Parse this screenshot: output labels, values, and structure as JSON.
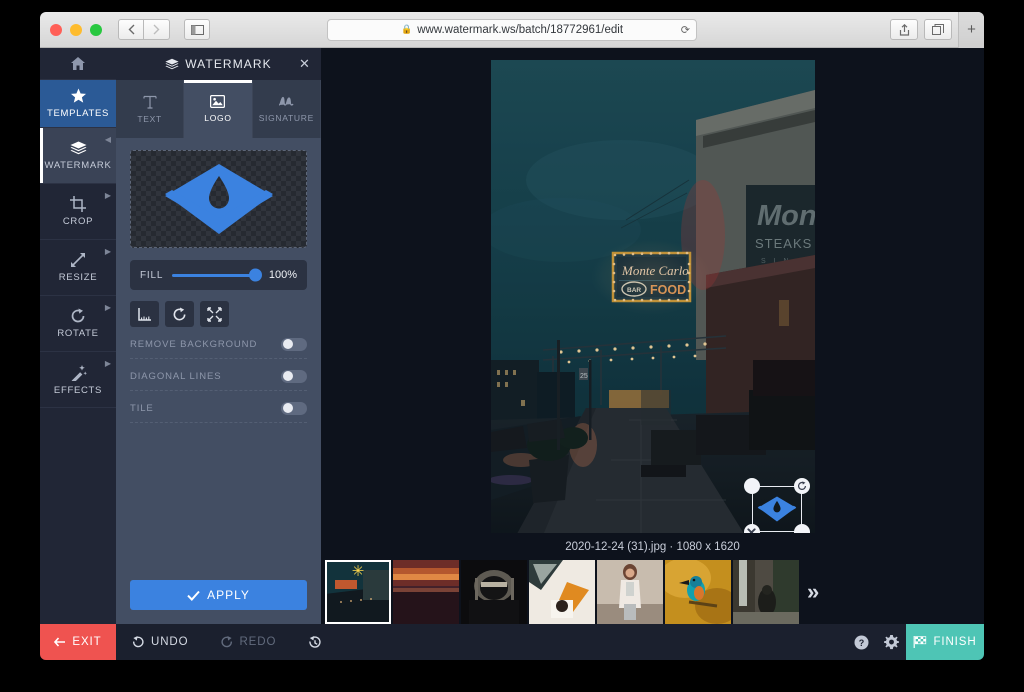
{
  "browser": {
    "url": "www.watermark.ws/batch/18772961/edit",
    "lock_icon": "lock-icon",
    "reload_icon": "reload-icon",
    "back_icon": "chevron-left-icon",
    "forward_icon": "chevron-right-icon",
    "sidebar_icon": "sidebar-toggle-icon",
    "share_icon": "share-icon",
    "tabs_icon": "show-tabs-icon",
    "new_tab_icon": "plus-icon"
  },
  "rail": {
    "home_icon": "home-icon",
    "items": [
      {
        "label": "TEMPLATES",
        "icon": "star-icon",
        "state": "accent"
      },
      {
        "label": "WATERMARK",
        "icon": "layers-icon",
        "state": "active"
      },
      {
        "label": "CROP",
        "icon": "crop-icon",
        "state": "normal"
      },
      {
        "label": "RESIZE",
        "icon": "resize-icon",
        "state": "normal"
      },
      {
        "label": "ROTATE",
        "icon": "rotate-icon",
        "state": "normal"
      },
      {
        "label": "EFFECTS",
        "icon": "magic-wand-icon",
        "state": "normal"
      }
    ]
  },
  "panel": {
    "title": "WATERMARK",
    "title_icon": "layers-icon",
    "close_icon": "close-icon",
    "tabs": [
      {
        "label": "TEXT",
        "icon": "text-icon"
      },
      {
        "label": "LOGO",
        "icon": "image-icon"
      },
      {
        "label": "SIGNATURE",
        "icon": "signature-icon"
      }
    ],
    "selected_tab": "LOGO",
    "logo_preview_name": "watermark-logo-droplet",
    "fill": {
      "label": "FILL",
      "value": "100%",
      "percent": 100
    },
    "tools": [
      {
        "name": "align-icon",
        "glyph": "align"
      },
      {
        "name": "rotate-icon",
        "glyph": "rotate"
      },
      {
        "name": "fit-icon",
        "glyph": "fit"
      }
    ],
    "toggles": [
      {
        "label": "REMOVE BACKGROUND",
        "on": false
      },
      {
        "label": "DIAGONAL LINES",
        "on": false
      },
      {
        "label": "TILE",
        "on": false
      }
    ],
    "apply_label": "APPLY",
    "apply_icon": "check-icon"
  },
  "canvas": {
    "caption": "2020-12-24 (31).jpg · 1080 x 1620",
    "photo_alt": "monte-carlo-neon-street-at-dusk",
    "signs": {
      "neon_title": "Monte Carlo",
      "neon_badge": "BAR",
      "neon_food": "FOOD",
      "wall_brand": "Mon",
      "wall_steaks": "STEAKS",
      "wall_since": "S I N"
    },
    "watermark_overlay": {
      "name": "watermark-transform-box",
      "handles": [
        {
          "name": "resize-handle-top-left",
          "glyph": ""
        },
        {
          "name": "rotate-handle",
          "glyph": "⟳"
        },
        {
          "name": "delete-handle",
          "glyph": "✕"
        },
        {
          "name": "resize-handle-bottom-right",
          "glyph": ""
        }
      ]
    }
  },
  "thumbnails": {
    "more_glyph": "»",
    "items": [
      {
        "name": "thumb-monte-carlo",
        "selected": true,
        "starred": true
      },
      {
        "name": "thumb-sunset-beach",
        "selected": false,
        "starred": false
      },
      {
        "name": "thumb-night-market",
        "selected": false,
        "starred": false
      },
      {
        "name": "thumb-desk-flatlay",
        "selected": false,
        "starred": false
      },
      {
        "name": "thumb-woman-street",
        "selected": false,
        "starred": false
      },
      {
        "name": "thumb-kingfisher",
        "selected": false,
        "starred": false
      },
      {
        "name": "thumb-waterfall-hiker",
        "selected": false,
        "starred": false
      }
    ]
  },
  "footer": {
    "exit_label": "EXIT",
    "exit_icon": "arrow-left-icon",
    "undo_label": "UNDO",
    "undo_icon": "undo-icon",
    "redo_label": "REDO",
    "redo_icon": "redo-icon",
    "history_icon": "history-icon",
    "help_icon": "help-icon",
    "settings_icon": "gear-icon",
    "finish_label": "FINISH",
    "finish_icon": "checkered-flag-icon"
  },
  "colors": {
    "accent_blue": "#3b82e0",
    "rail_selected_blue": "#2b5a96",
    "panel_bg": "#434e63",
    "rail_bg": "#212636",
    "exit_red": "#ef5350",
    "finish_teal": "#4ec5b5",
    "star_yellow": "#ffd84d"
  }
}
